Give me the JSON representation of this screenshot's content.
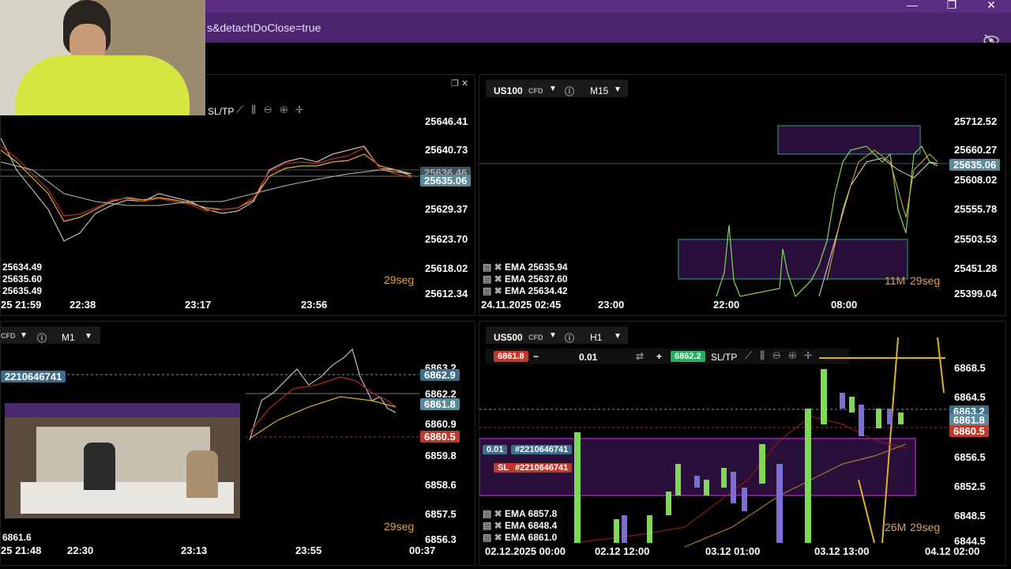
{
  "window": {
    "address_text": "s&detachDoClose=true",
    "minimize": "—",
    "maximize": "❐",
    "close": "✕"
  },
  "top_left": {
    "toolbar_label": "SL/TP",
    "prices": [
      "25646.41",
      "25640.73",
      "25636.46",
      "25629.37",
      "25623.70",
      "25618.02",
      "25612.34"
    ],
    "current_price": "25635.06",
    "ema_values": [
      "25634.49",
      "25635.60",
      "25635.49"
    ],
    "times": [
      "25 21:59",
      "22:38",
      "23:17",
      "23:56"
    ],
    "countdown": "29seg"
  },
  "top_right": {
    "symbol": "US100",
    "badge": "CFD",
    "timeframe": "M15",
    "prices": [
      "25712.52",
      "25660.27",
      "25608.02",
      "25555.78",
      "25503.53",
      "25451.28",
      "25399.04"
    ],
    "current_price": "25635.06",
    "ema_values": [
      "EMA 25635.94",
      "EMA 25637.60",
      "EMA 25634.42"
    ],
    "times": [
      "24.11.2025 02:45",
      "23:00",
      "22:00",
      "08:00"
    ],
    "countdown_prefix": "11M",
    "countdown": "29seg"
  },
  "bottom_left": {
    "badge": "CFD",
    "timeframe": "M1",
    "order_id": "2210646741",
    "prices": [
      "6863.2",
      "6862.9",
      "6862.2",
      "6861.8",
      "6860.9",
      "6860.5",
      "6859.8",
      "6858.6",
      "6857.5",
      "6856.3"
    ],
    "ema_value": "6861.6",
    "times": [
      "25 21:48",
      "22:30",
      "23:13",
      "23:55",
      "00:37"
    ],
    "countdown": "29seg"
  },
  "bottom_right": {
    "symbol": "US500",
    "badge": "CFD",
    "timeframe": "H1",
    "sell_price": "6861.8",
    "lot": "0.01",
    "buy_price": "6862.2",
    "sltp": "SL/TP",
    "position_lot": "0.01",
    "order_id": "#2210646741",
    "sl_label": "SL",
    "sl_order": "#2210646741",
    "prices": [
      "6868.5",
      "6864.5",
      "6863.2",
      "6861.8",
      "6860.5",
      "6856.5",
      "6852.5",
      "6848.5",
      "6844.5"
    ],
    "ema_values": [
      "EMA 6857.8",
      "EMA 6848.4",
      "EMA 6861.0"
    ],
    "times": [
      "02.12.2025 00:00",
      "02.12 12:00",
      "03.12 01:00",
      "03.12 13:00",
      "04.12 02:00"
    ],
    "countdown_prefix": "26M",
    "countdown": "29seg"
  },
  "colors": {
    "titlebar": "#5b2d82",
    "address": "#4a246e",
    "bull": "#7ed957",
    "bear": "#7b6fd6",
    "zone": "#2a0f3a",
    "zone_border": "#2aa3a0",
    "countdown": "#e0a24a"
  }
}
